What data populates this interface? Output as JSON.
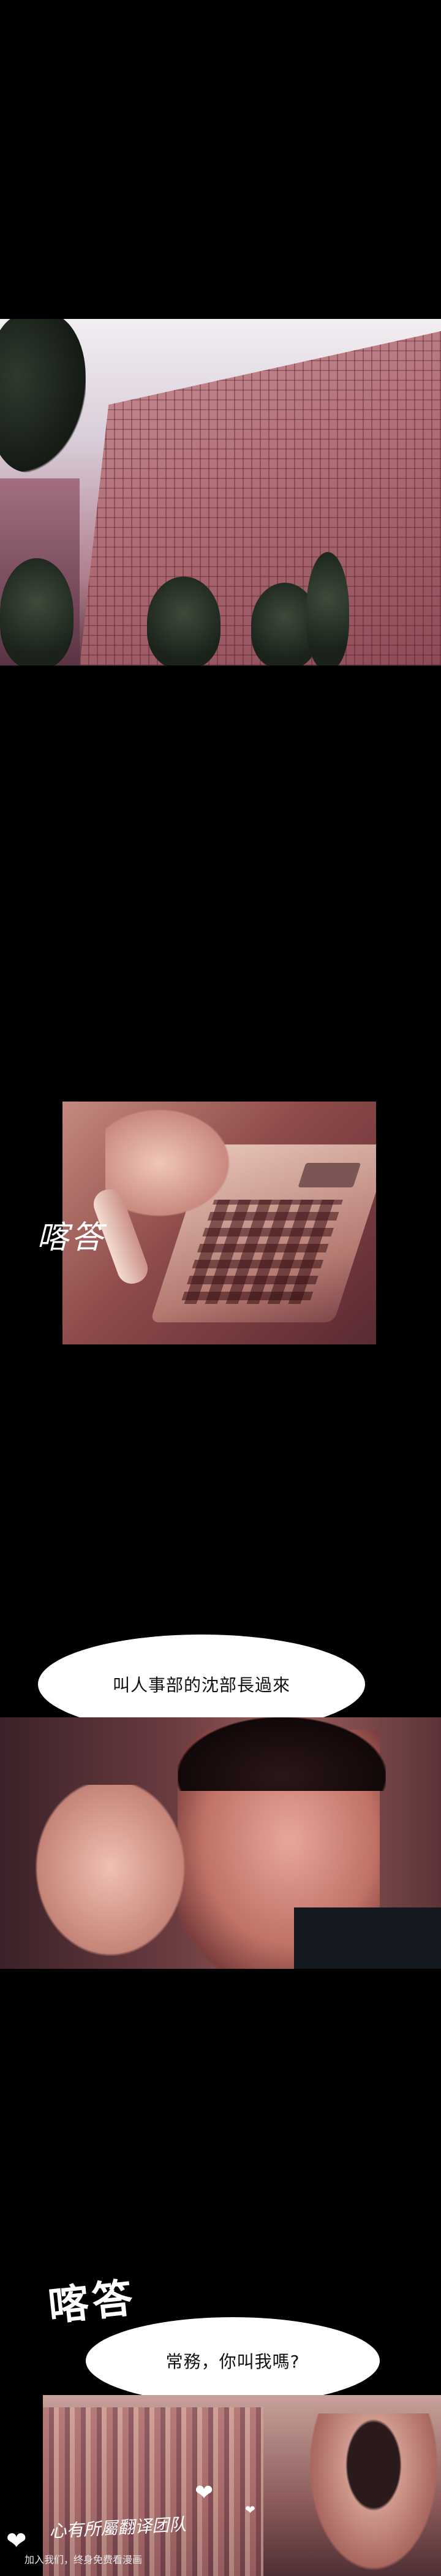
{
  "panels": {
    "p2_sfx": "喀答",
    "p3_bubble": "叫人事部的沈部長過來",
    "p4_sfx": "喀答",
    "p4_bubble": "常務，你叫我嗎?"
  },
  "watermark": {
    "group": "心有所屬翻译团队",
    "slogan": "加入我们，终身免费看漫画"
  },
  "colors": {
    "background": "#000000",
    "bubble": "#ffffff",
    "text": "#111111"
  }
}
